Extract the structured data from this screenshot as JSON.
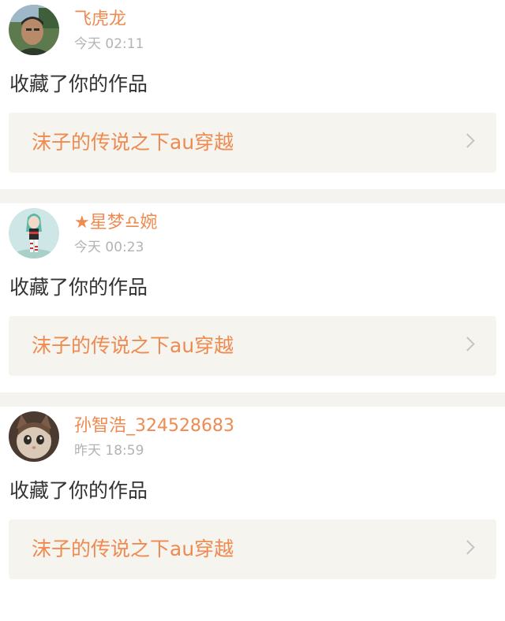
{
  "feed": {
    "items": [
      {
        "avatar_icon": "user-avatar-photo-man",
        "username": "飞虎龙",
        "timestamp": "今天 02:11",
        "action": "收藏了你的作品",
        "work_title": "沫子的传说之下au穿越",
        "chevron_icon": "chevron-right-icon"
      },
      {
        "avatar_icon": "user-avatar-anime-girl",
        "username": "★星梦♎婉",
        "timestamp": "今天 00:23",
        "action": "收藏了你的作品",
        "work_title": "沫子的传说之下au穿越",
        "chevron_icon": "chevron-right-icon"
      },
      {
        "avatar_icon": "user-avatar-cat",
        "username": "孙智浩_324528683",
        "timestamp": "昨天 18:59",
        "action": "收藏了你的作品",
        "work_title": "沫子的传说之下au穿越",
        "chevron_icon": "chevron-right-icon"
      }
    ]
  },
  "colors": {
    "accent": "#ef8a50",
    "timestamp": "#b3b3b3",
    "text": "#333333",
    "card_background": "#f5f4ef",
    "divider": "#f4f3ef"
  }
}
